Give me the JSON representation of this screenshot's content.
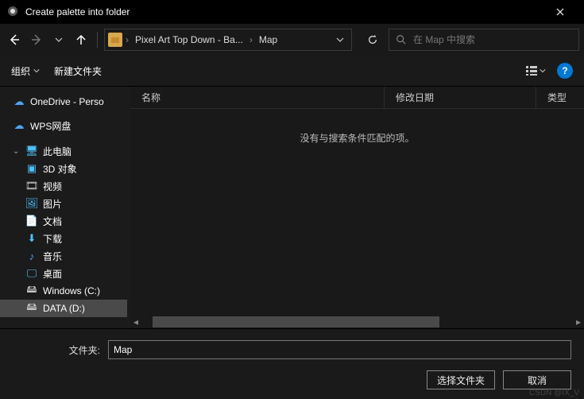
{
  "title": "Create palette into folder",
  "breadcrumbs": [
    "Pixel Art Top Down - Ba...",
    "Map"
  ],
  "search_placeholder": "在 Map 中搜索",
  "toolbar": {
    "organize": "组织",
    "new_folder": "新建文件夹",
    "help": "?"
  },
  "sidebar": [
    {
      "label": "OneDrive - Perso"
    },
    {
      "label": "WPS网盘"
    },
    {
      "label": "此电脑"
    },
    {
      "label": "3D 对象"
    },
    {
      "label": "视频"
    },
    {
      "label": "图片"
    },
    {
      "label": "文档"
    },
    {
      "label": "下载"
    },
    {
      "label": "音乐"
    },
    {
      "label": "桌面"
    },
    {
      "label": "Windows (C:)"
    },
    {
      "label": "DATA (D:)"
    }
  ],
  "columns": [
    "名称",
    "修改日期",
    "类型"
  ],
  "empty_message": "没有与搜索条件匹配的项。",
  "footer": {
    "label": "文件夹:",
    "value": "Map",
    "select": "选择文件夹",
    "cancel": "取消"
  },
  "watermark": "CSDN @IX_V"
}
